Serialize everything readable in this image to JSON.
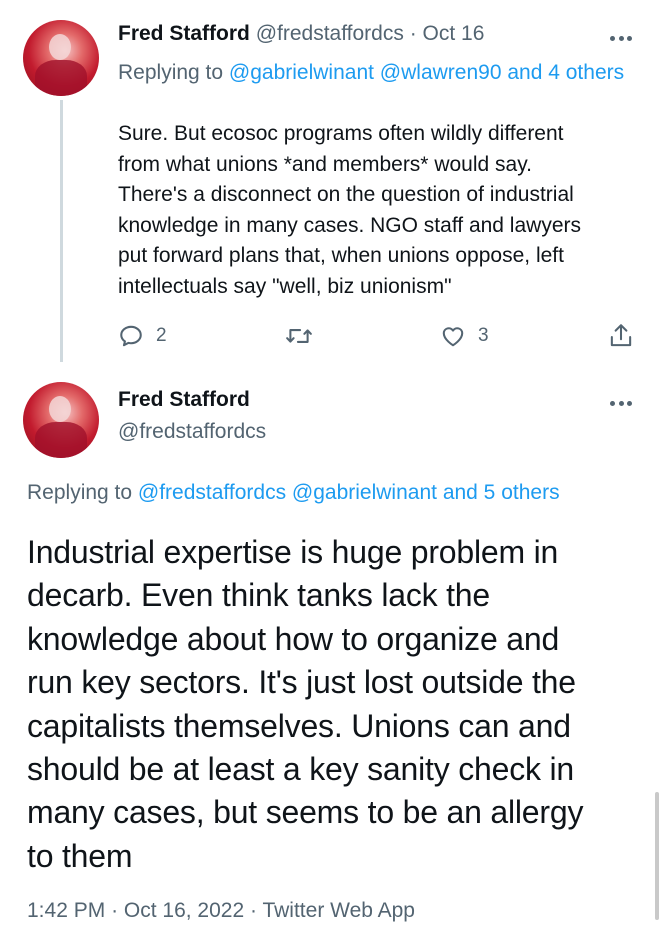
{
  "parent_tweet": {
    "display_name": "Fred Stafford",
    "handle": "@fredstaffordcs",
    "separator": "·",
    "date": "Oct 16",
    "replying_prefix": "Replying to",
    "replying_mentions": "@gabrielwinant @wlawren90",
    "replying_others": "and 4 others",
    "body_lines": [
      "Sure. But ecosoc programs often wildly different",
      "from what unions *and members* would say.",
      "There's a disconnect on the question of industrial",
      "knowledge in many cases. NGO staff and lawyers",
      "put forward plans that, when unions oppose, left",
      "intellectuals say \"well, biz unionism\""
    ],
    "actions": {
      "reply_count": "2",
      "retweet_count": "",
      "like_count": "3"
    },
    "icons": [
      "more-icon",
      "reply-icon",
      "retweet-icon",
      "like-icon",
      "share-icon"
    ]
  },
  "main_tweet": {
    "display_name": "Fred Stafford",
    "handle": "@fredstaffordcs",
    "replying_prefix": "Replying to",
    "replying_mentions": "@fredstaffordcs @gabrielwinant",
    "replying_others": "and 5 others",
    "body_lines": [
      "Industrial expertise is huge problem in",
      "decarb. Even think tanks lack the",
      "knowledge about how to organize and",
      "run key sectors. It's just lost outside the",
      "capitalists themselves. Unions can and",
      "should be at least a key sanity check in",
      "many cases, but seems to be an allergy",
      "to them"
    ],
    "time": "1:42 PM",
    "date": "Oct 16, 2022",
    "source": "Twitter Web App",
    "meta_separator": "·"
  },
  "colors": {
    "link": "#1d9bf0",
    "muted": "#536471",
    "text": "#0f1419",
    "thread_line": "#cfd9de"
  }
}
